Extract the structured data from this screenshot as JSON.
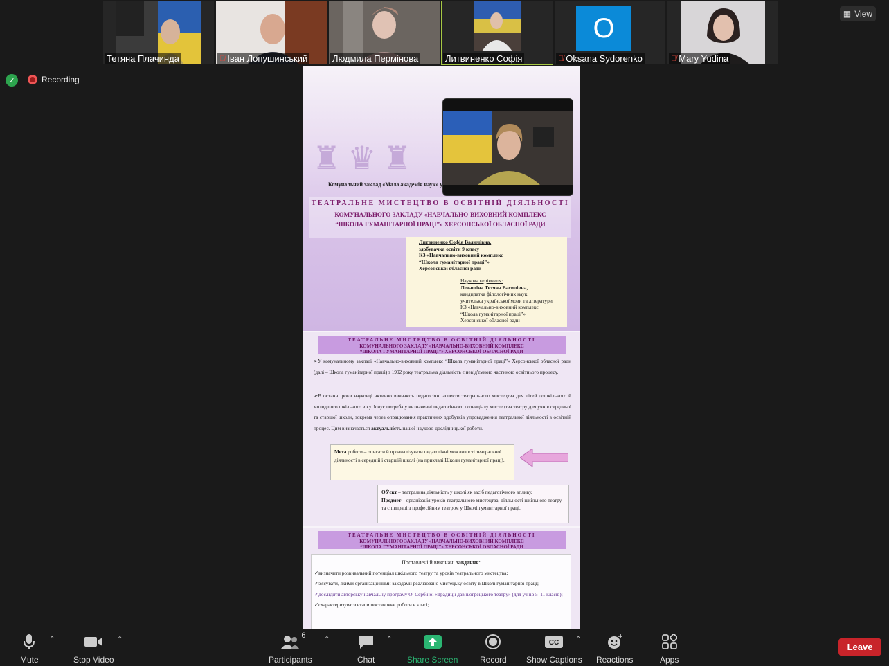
{
  "participants": [
    {
      "name": "Тетяна Плачинда",
      "muted": false,
      "active": false
    },
    {
      "name": "Іван Лопушинський",
      "muted": true,
      "active": false
    },
    {
      "name": "Людмила Пермінова",
      "muted": false,
      "active": false
    },
    {
      "name": "Литвиненко Софія",
      "muted": false,
      "active": true
    },
    {
      "name": "Oksana Sydorenko",
      "muted": true,
      "active": false,
      "avatar_letter": "O"
    },
    {
      "name": "Mary Yudina",
      "muted": true,
      "active": false
    }
  ],
  "view_label": "View",
  "recording_label": "Recording",
  "document": {
    "slide1": {
      "institution": "Комунальний заклад «Мала академія наук» у",
      "title1": "ТЕАТРАЛЬНЕ МИСТЕЦТВО В ОСВІТНІЙ ДІЯЛЬНОСТІ",
      "title2": "КОМУНАЛЬНОГО ЗАКЛАДУ «НАВЧАЛЬНО-ВИХОВНИЙ КОМПЛЕКС",
      "title3": "“ШКОЛА ГУМАНІТАРНОЇ ПРАЦІ”» ХЕРСОНСЬКОЇ ОБЛАСНОЇ РАДИ",
      "author": [
        "Литвиненко Софія Вадимівна,",
        "здобувачка освіти 9 класу",
        "КЗ «Навчально-виховний комплекс",
        "“Школа гуманітарної праці”»",
        "Херсонської обласної ради"
      ],
      "supervisor": [
        "Наукова керівниця:",
        "Левашіна Тетяна Василівна,",
        "кандидатка філологічних наук,",
        "учителька української мови та літератури",
        "КЗ «Навчально-виховний комплекс",
        "“Школа гуманітарної праці”»",
        "Херсонської обласної ради"
      ]
    },
    "slide_header": [
      "ТЕАТРАЛЬНЕ МИСТЕЦТВО В ОСВІТНІЙ ДІЯЛЬНОСТІ",
      "КОМУНАЛЬНОГО ЗАКЛАДУ «НАВЧАЛЬНО-ВИХОВНИЙ КОМПЛЕКС",
      "“ШКОЛА ГУМАНІТАРНОЇ ПРАЦІ”» ХЕРСОНСЬКОЇ ОБЛАСНОЇ РАДИ"
    ],
    "slide2": {
      "p1": "➢У комунальному закладі «Навчально-виховний комплекс “Школа гуманітарної праці”» Херсонської обласної ради (далі – Школа гуманітарної праці) з 1992 року театральна діяльність є невід'ємною частиною освітнього процесу.",
      "p2": "➢В останні роки науковці активно вивчають педагогічні аспекти театрального мистецтва для дітей дошкільного й молодшого шкільного віку. Існує потреба у визначенні педагогічного потенціалу мистецтва театру для учнів середньої та старшої школи, зокрема через опрацювання практичних здобутків упровадження театральної діяльності в освітній процес. Цим визначається",
      "p2_bold": "актуальність",
      "p2_end": "нашої науково-дослідницької роботи.",
      "goal_label": "Мета",
      "goal": "роботи – описати й проаналізувати педагогічні можливості театральної діяльності в середній і старшій школі (на прикладі Школи гуманітарної праці).",
      "object_label": "Об'єкт",
      "object": "– театральна діяльність у школі як засіб педагогічного впливу.",
      "subject_label": "Предмет",
      "subject": "– організація уроків театрального мистецтва, діяльності шкільного театру та співпраці з професійним театром у Школі гуманітарної праці."
    },
    "slide3": {
      "heading": "Поставлені й виконані",
      "heading_bold": "завдання",
      "items": [
        "✓визначити розвивальний потенціал шкільного театру та уроків театрального мистецтва;",
        "✓з'ясувати, якими організаційними заходами реалізовано мистецьку освіту в Школі гуманітарної праці;",
        "✓дослідити авторську навчальну програму О. Сербіної «Традиції давньогрецького театру» (для учнів 5–11 класів);",
        "✓схарактеризувати етапи постановки роботи в класі;"
      ]
    }
  },
  "toolbar": {
    "mute": "Mute",
    "stop_video": "Stop Video",
    "participants": "Participants",
    "participants_count": "6",
    "chat": "Chat",
    "share_screen": "Share Screen",
    "record": "Record",
    "show_captions": "Show Captions",
    "reactions": "Reactions",
    "apps": "Apps",
    "leave": "Leave"
  },
  "colors": {
    "share_green": "#2bb673",
    "leave_red": "#c8242a",
    "active_outline": "#a7c844"
  }
}
